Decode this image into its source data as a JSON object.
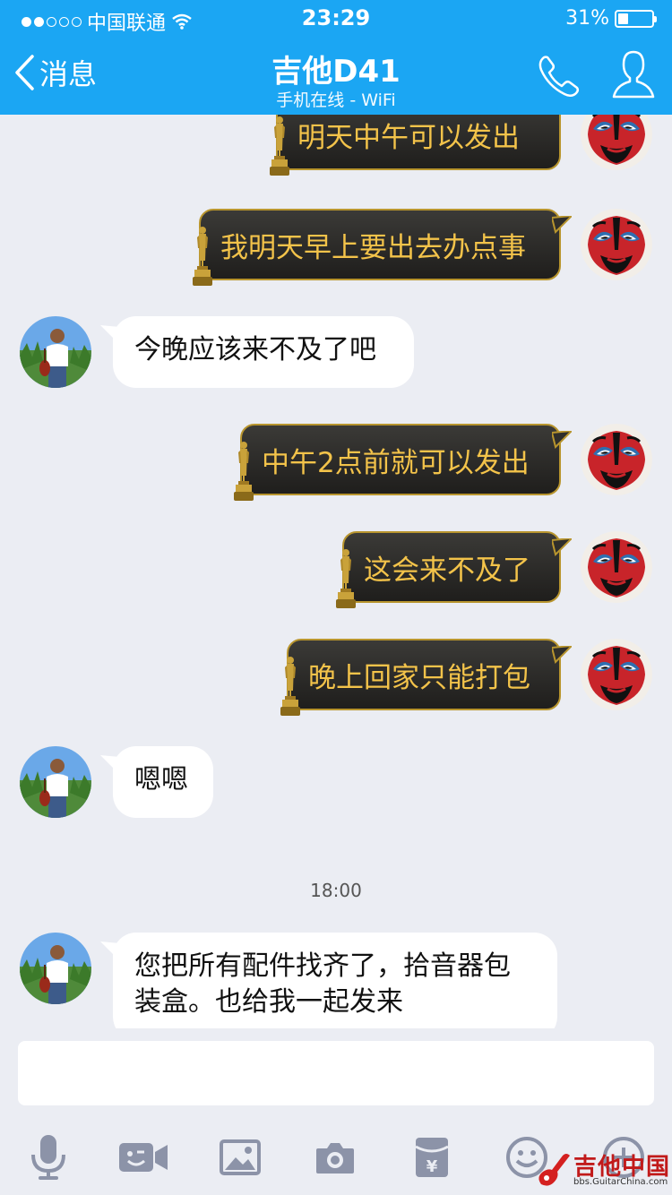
{
  "status_bar": {
    "carrier": "中国联通",
    "time": "23:29",
    "battery": "31%",
    "battery_level": 0.31
  },
  "nav": {
    "back_label": "消息",
    "title": "吉他D41",
    "subtitle": "手机在线 - WiFi"
  },
  "messages": [
    {
      "direction": "out",
      "text": "明天中午可以发出"
    },
    {
      "direction": "out",
      "text": "我明天早上要出去办点事"
    },
    {
      "direction": "in",
      "text": "今晚应该来不及了吧"
    },
    {
      "direction": "out",
      "text": "中午2点前就可以发出"
    },
    {
      "direction": "out",
      "text": "这会来不及了"
    },
    {
      "direction": "out",
      "text": "晚上回家只能打包"
    },
    {
      "direction": "in",
      "text": "嗯嗯"
    },
    {
      "direction": "in",
      "text": "您把所有配件找齐了，拾音器包装盒。也给我一起发来"
    }
  ],
  "timestamp": "18:00",
  "toolbar": {
    "icons": [
      "microphone-icon",
      "video-icon",
      "image-icon",
      "camera-icon",
      "red-packet-icon",
      "emoji-icon",
      "plus-icon"
    ],
    "yuan_symbol": "¥"
  },
  "watermark": {
    "title": "吉他中国",
    "url": "bbs.GuitarChina.com"
  },
  "colors": {
    "header": "#1ba6f3",
    "background": "#ebedf3",
    "bubble_out": "#2a2926",
    "bubble_out_text": "#f3c34a",
    "bubble_in": "#ffffff"
  }
}
